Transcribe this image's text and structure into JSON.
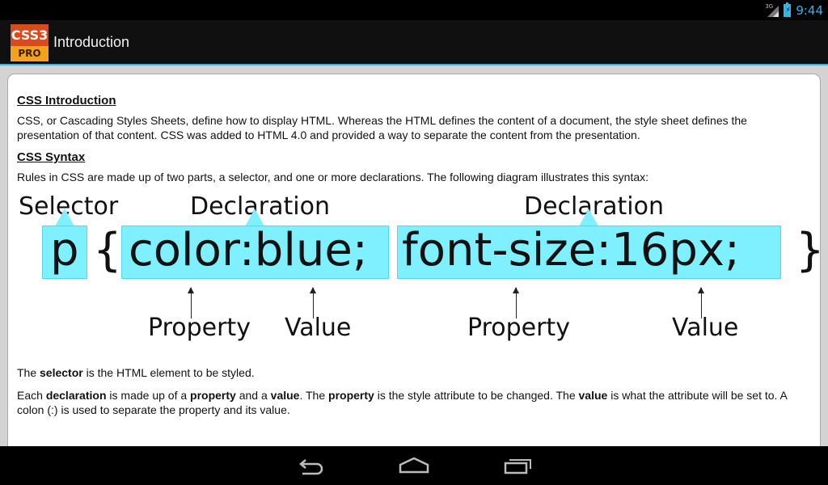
{
  "status": {
    "time": "9:44",
    "network": "3G"
  },
  "app": {
    "logo_top": "CSS3",
    "logo_bottom": "PRO",
    "title": "Introduction"
  },
  "content": {
    "intro_heading": "CSS Introduction",
    "intro_text": "CSS, or Cascading Styles Sheets, define how to display HTML. Whereas the HTML defines the content of a document, the style sheet defines the presentation of that content. CSS was added to HTML 4.0 and provided a way to separate the content from the presentation.",
    "syntax_heading": "CSS Syntax",
    "syntax_text": "Rules in CSS are made up of two parts, a selector, and one or more declarations. The following diagram illustrates this syntax:",
    "diagram": {
      "selector_label": "Selector",
      "declaration_label_1": "Declaration",
      "declaration_label_2": "Declaration",
      "selector_code": "p",
      "open_brace": "{",
      "close_brace": "}",
      "decl1_code": "color:blue;",
      "decl2_code": "font-size:16px;",
      "property_label_1": "Property",
      "value_label_1": "Value",
      "property_label_2": "Property",
      "value_label_2": "Value"
    },
    "selector_sentence": {
      "pre": "The ",
      "bold": "selector",
      "post": " is the HTML element to be styled."
    },
    "declaration_sentence": {
      "t1": "Each ",
      "b1": "declaration",
      "t2": " is made up of a ",
      "b2": "property",
      "t3": " and a ",
      "b3": "value",
      "t4": ". The ",
      "b4": "property",
      "t5": " is the style attribute to be changed. The ",
      "b5": "value",
      "t6": " is what the attribute will be set to. A colon (:) is used to separate the property and its value."
    }
  },
  "colors": {
    "accent": "#33b5e5",
    "highlight": "#7ff0ff",
    "logo_red": "#d94b1f",
    "logo_orange": "#f5a21b"
  },
  "nav": {
    "back": "back-icon",
    "home": "home-icon",
    "recents": "recents-icon"
  }
}
